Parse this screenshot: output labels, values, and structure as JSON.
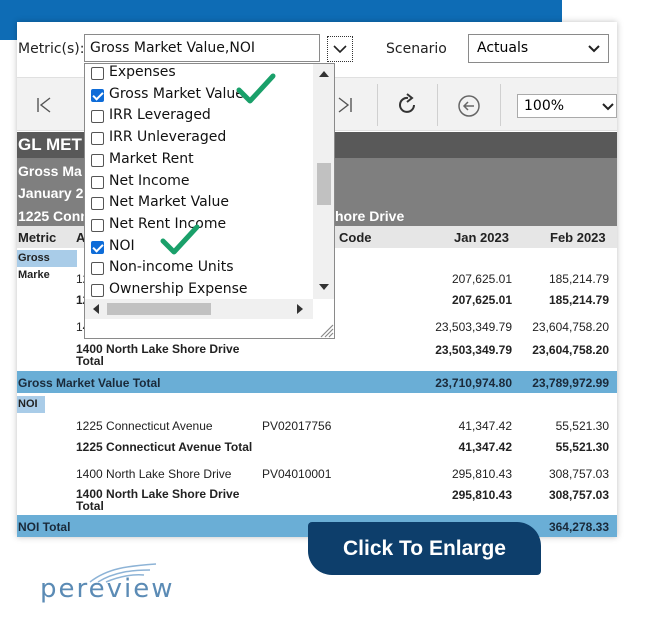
{
  "filters": {
    "metric_label": "Metric(s):",
    "metric_value": "Gross Market Value,NOI",
    "scenario_label": "Scenario",
    "scenario_value": "Actuals"
  },
  "metric_options": [
    {
      "label": "Expenses",
      "checked": false
    },
    {
      "label": "Gross Market Value",
      "checked": true
    },
    {
      "label": "IRR Leveraged",
      "checked": false
    },
    {
      "label": "IRR Unleveraged",
      "checked": false
    },
    {
      "label": "Market Rent",
      "checked": false
    },
    {
      "label": "Net Income",
      "checked": false
    },
    {
      "label": "Net Market Value",
      "checked": false
    },
    {
      "label": "Net Rent Income",
      "checked": false
    },
    {
      "label": "NOI",
      "checked": true
    },
    {
      "label": "Non-income Units",
      "checked": false
    },
    {
      "label": "Ownership Expense",
      "checked": false
    }
  ],
  "toolbar": {
    "zoom": "100%"
  },
  "report": {
    "title": "GL MET",
    "subtitle1": "Gross Ma",
    "subtitle2": "January 2",
    "property_header_left": "1225 Conn",
    "property_header_right": "hore Drive",
    "columns": {
      "metric": "Metric",
      "a": "A",
      "code": "Code",
      "jan": "Jan 2023",
      "feb": "Feb 2023"
    },
    "section_gmv": "Gross Marke",
    "gmv_rows": {
      "r1_prefix": "12",
      "r1_jan": "207,625.01",
      "r1_feb": "185,214.79",
      "r2_prefix": "12",
      "r2_jan": "207,625.01",
      "r2_feb": "185,214.79",
      "r3_prefix": "14",
      "r3_jan": "23,503,349.79",
      "r3_feb": "23,604,758.20",
      "r4_name": "1400 North Lake Shore Drive Total",
      "r4_jan": "23,503,349.79",
      "r4_feb": "23,604,758.20"
    },
    "gmv_total": {
      "label": "Gross Market Value Total",
      "jan": "23,710,974.80",
      "feb": "23,789,972.99"
    },
    "section_noi": "NOI",
    "noi_rows": {
      "r1_name": "1225 Connecticut Avenue",
      "r1_code": "PV02017756",
      "r1_jan": "41,347.42",
      "r1_feb": "55,521.30",
      "r2_name": "1225 Connecticut Avenue Total",
      "r2_jan": "41,347.42",
      "r2_feb": "55,521.30",
      "r3_name": "1400 North Lake Shore Drive",
      "r3_code": "PV04010001",
      "r3_jan": "295,810.43",
      "r3_feb": "308,757.03",
      "r4_name": "1400 North Lake Shore Drive Total",
      "r4_jan": "295,810.43",
      "r4_feb": "308,757.03"
    },
    "noi_total": {
      "label": "NOI Total",
      "feb": "364,278.33"
    }
  },
  "cta_label": "Click To Enlarge",
  "brand": "pereview",
  "colors": {
    "brand_blue": "#0e6cb5",
    "cta_navy": "#0d3e6b",
    "check_green": "#1aa06a",
    "total_blue": "#6aaed6"
  }
}
